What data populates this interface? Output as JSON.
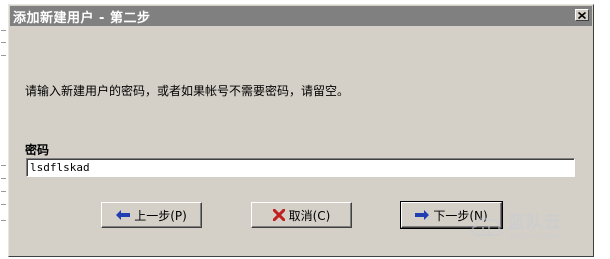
{
  "dialog": {
    "title": "添加新建用户 - 第二步",
    "instruction": "请输入新建用户的密码，或者如果帐号不需要密码，请留空。",
    "password_label": "密码",
    "password_value": "lsdflskad"
  },
  "buttons": {
    "back": "上一步(P)",
    "cancel": "取消(C)",
    "next": "下一步(N)"
  },
  "watermark": {
    "text_cn": "蓝队云",
    "text_en": "LanDui.com"
  },
  "colors": {
    "dialog_bg": "#d4d0c8",
    "titlebar_bg": "#808080",
    "arrow_blue": "#1f3fb3",
    "cancel_red": "#c0201f"
  },
  "icons": {
    "back": "arrow-left-icon",
    "cancel": "x-mark-icon",
    "next": "arrow-right-icon",
    "close": "close-icon"
  }
}
